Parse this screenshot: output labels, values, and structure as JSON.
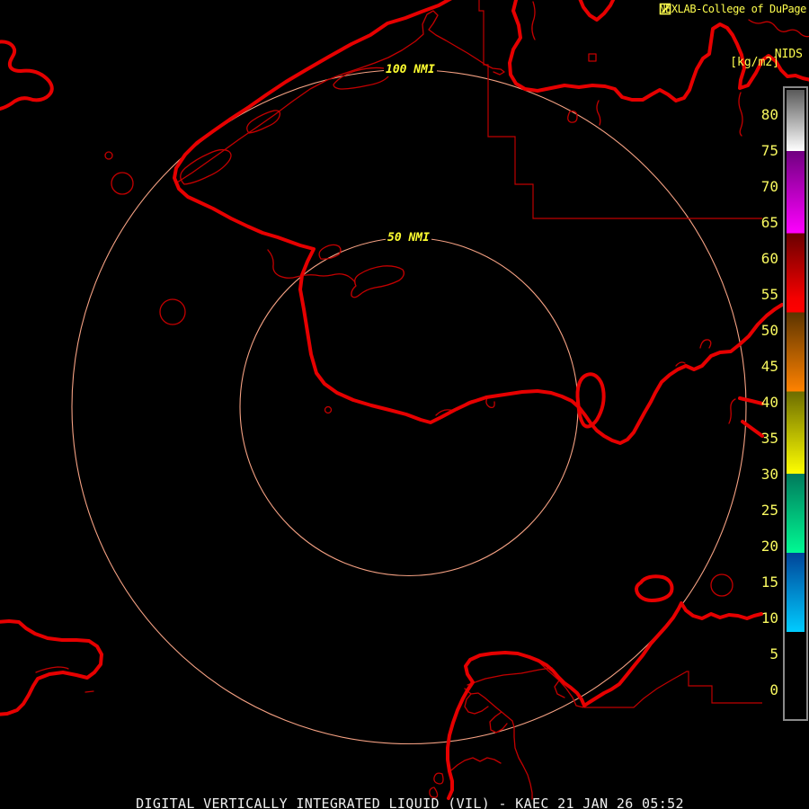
{
  "header": {
    "title": "NEXLAB-College of DuPage",
    "logo": "flag-box-icon"
  },
  "colorbar": {
    "title": "NIDS",
    "unit": "[kg/m2]",
    "ticks": [
      80,
      75,
      70,
      65,
      60,
      55,
      50,
      45,
      40,
      35,
      30,
      25,
      20,
      15,
      10,
      5,
      0
    ],
    "value_top": 83.5,
    "value_bottom": -3.9,
    "segments": [
      {
        "from": 83.5,
        "to": 75,
        "top_color": "#5a5a5a",
        "bottom_color": "#ffffff"
      },
      {
        "from": 75,
        "to": 63.5,
        "top_color": "#700080",
        "bottom_color": "#ff00ff"
      },
      {
        "from": 63.5,
        "to": 54.5,
        "top_color": "#6a0000",
        "bottom_color": "#f40000"
      },
      {
        "from": 54.5,
        "to": 52.5,
        "top_color": "#f40000",
        "bottom_color": "#ff0000"
      },
      {
        "from": 52.5,
        "to": 41.5,
        "top_color": "#5c3400",
        "bottom_color": "#ff8200"
      },
      {
        "from": 41.5,
        "to": 30,
        "top_color": "#6c6c00",
        "bottom_color": "#ffff00"
      },
      {
        "from": 30,
        "to": 19,
        "top_color": "#007a5c",
        "bottom_color": "#00fa93"
      },
      {
        "from": 19,
        "to": 8,
        "top_color": "#004498",
        "bottom_color": "#00ccff"
      },
      {
        "from": 8,
        "to": -3.9,
        "top_color": "#000000",
        "bottom_color": "#000000"
      }
    ]
  },
  "range_rings": {
    "outer_label": "100 NMI",
    "inner_label": "50 NMI"
  },
  "status_bar": {
    "text": "DIGITAL VERTICALLY INTEGRATED LIQUID (VIL) - KAEC 21 JAN 26 05:52"
  },
  "colors": {
    "background": "#000000",
    "text_yellow": "#ffff4e",
    "text_white": "#f0f0f0",
    "map_red_thick": "#e60000",
    "map_red_thin": "#c40000",
    "ring_salmon": "#f5a183",
    "bar_border_gray": "#8a8a8a"
  }
}
